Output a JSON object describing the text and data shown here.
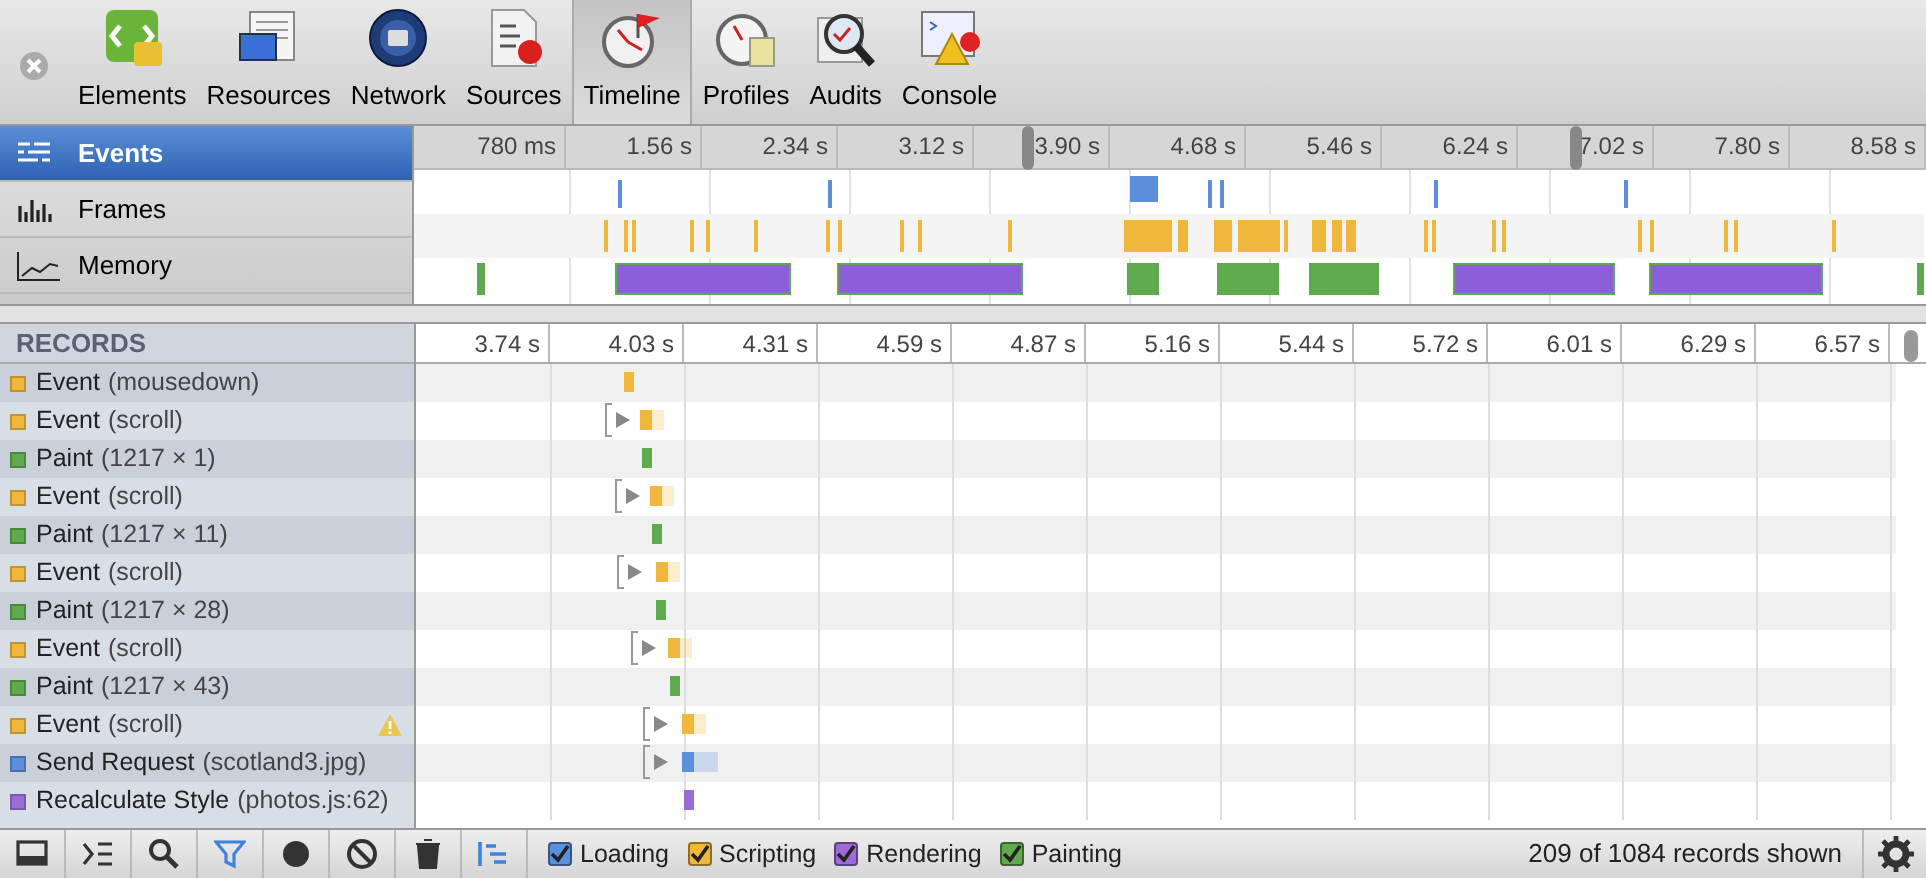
{
  "toolbar": {
    "tabs": [
      {
        "label": "Elements",
        "selected": false
      },
      {
        "label": "Resources",
        "selected": false
      },
      {
        "label": "Network",
        "selected": false
      },
      {
        "label": "Sources",
        "selected": false
      },
      {
        "label": "Timeline",
        "selected": true
      },
      {
        "label": "Profiles",
        "selected": false
      },
      {
        "label": "Audits",
        "selected": false
      },
      {
        "label": "Console",
        "selected": false
      }
    ]
  },
  "overview": {
    "modes": [
      {
        "label": "Events",
        "selected": true
      },
      {
        "label": "Frames",
        "selected": false
      },
      {
        "label": "Memory",
        "selected": false
      }
    ],
    "ruler": [
      "780 ms",
      "1.56 s",
      "2.34 s",
      "3.12 s",
      "3.90 s",
      "4.68 s",
      "5.46 s",
      "6.24 s",
      "7.02 s",
      "7.80 s",
      "8.58 s"
    ]
  },
  "records": {
    "title": "RECORDS",
    "ruler": [
      "3.74 s",
      "4.03 s",
      "4.31 s",
      "4.59 s",
      "4.87 s",
      "5.16 s",
      "5.44 s",
      "5.72 s",
      "6.01 s",
      "6.29 s",
      "6.57 s"
    ],
    "rows": [
      {
        "kind": "scripting",
        "name": "Event",
        "detail": "(mousedown)",
        "warning": false,
        "expanded": null
      },
      {
        "kind": "scripting",
        "name": "Event",
        "detail": "(scroll)",
        "warning": false,
        "expanded": false
      },
      {
        "kind": "painting",
        "name": "Paint",
        "detail": "(1217 × 1)",
        "warning": false,
        "expanded": null
      },
      {
        "kind": "scripting",
        "name": "Event",
        "detail": "(scroll)",
        "warning": false,
        "expanded": false
      },
      {
        "kind": "painting",
        "name": "Paint",
        "detail": "(1217 × 11)",
        "warning": false,
        "expanded": null
      },
      {
        "kind": "scripting",
        "name": "Event",
        "detail": "(scroll)",
        "warning": false,
        "expanded": false
      },
      {
        "kind": "painting",
        "name": "Paint",
        "detail": "(1217 × 28)",
        "warning": false,
        "expanded": null
      },
      {
        "kind": "scripting",
        "name": "Event",
        "detail": "(scroll)",
        "warning": false,
        "expanded": false
      },
      {
        "kind": "painting",
        "name": "Paint",
        "detail": "(1217 × 43)",
        "warning": false,
        "expanded": null
      },
      {
        "kind": "scripting",
        "name": "Event",
        "detail": "(scroll)",
        "warning": true,
        "expanded": false
      },
      {
        "kind": "loading",
        "name": "Send Request",
        "detail": "(scotland3.jpg)",
        "warning": false,
        "expanded": false
      },
      {
        "kind": "rendering",
        "name": "Recalculate Style",
        "detail": "(photos.js:62)",
        "warning": false,
        "expanded": null
      }
    ]
  },
  "status_bar": {
    "buttons": [
      {
        "selected": false
      },
      {
        "selected": false
      },
      {
        "selected": false
      },
      {
        "selected": true
      },
      {
        "selected": false
      },
      {
        "selected": false
      },
      {
        "selected": false
      },
      {
        "selected": true
      }
    ],
    "categories": [
      {
        "kind": "loading",
        "label": "Loading",
        "checked": true
      },
      {
        "kind": "scripting",
        "label": "Scripting",
        "checked": true
      },
      {
        "kind": "rendering",
        "label": "Rendering",
        "checked": true
      },
      {
        "kind": "painting",
        "label": "Painting",
        "checked": true
      }
    ],
    "summary": "209 of 1084 records shown"
  }
}
